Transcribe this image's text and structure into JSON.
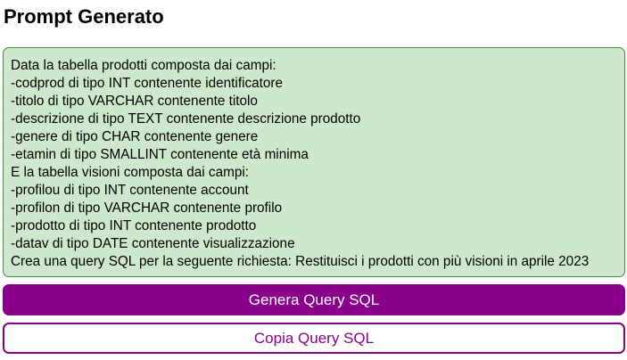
{
  "page": {
    "title": "Prompt Generato"
  },
  "prompt": {
    "lines": [
      "Data la tabella prodotti composta dai campi:",
      "-codprod di tipo INT contenente identificatore",
      "-titolo di tipo VARCHAR contenente titolo",
      "-descrizione di tipo TEXT contenente descrizione prodotto",
      "-genere di tipo CHAR contenente genere",
      "-etamin di tipo SMALLINT contenente età minima",
      "E la tabella visioni composta dai campi:",
      "-profilou di tipo INT contenente account",
      "-profilon di tipo VARCHAR contenente profilo",
      "-prodotto di tipo INT contenente prodotto",
      "-datav di tipo DATE contenente visualizzazione",
      "Crea una query SQL per la seguente richiesta: Restituisci i prodotti con più visioni in aprile 2023"
    ]
  },
  "actions": {
    "generate_label": "Genera Query SQL",
    "copy_label": "Copia Query SQL"
  },
  "colors": {
    "accent": "#8b008b",
    "prompt_background": "#cde8cc",
    "prompt_border": "#3f8f3f"
  }
}
